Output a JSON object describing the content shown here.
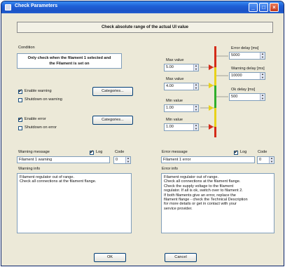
{
  "window": {
    "title": "Check Parameters"
  },
  "banner": "Check absolute range of the actual UI value",
  "condition": {
    "label": "Condition",
    "text": "Only check when the filament 1 selected and\nthe Filament is set on"
  },
  "checks": {
    "enable_warning": "Enable warning",
    "shutdown_warning": "Shutdown on warning",
    "enable_error": "Enable error",
    "shutdown_error": "Shutdown on error"
  },
  "buttons": {
    "categories": "Categories...",
    "ok": "OK",
    "cancel": "Cancel"
  },
  "limits": {
    "max1": {
      "label": "Max value",
      "value": "5.00"
    },
    "max2": {
      "label": "Max value",
      "value": "4.00"
    },
    "min1": {
      "label": "Min value",
      "value": "1.00"
    },
    "min2": {
      "label": "Min value",
      "value": "1.00"
    }
  },
  "delays": {
    "error": {
      "label": "Error delay [ms]",
      "value": "5000"
    },
    "warning": {
      "label": "Warning delay [ms]",
      "value": "10000"
    },
    "ok": {
      "label": "Ok delay [ms]",
      "value": "500"
    }
  },
  "warning": {
    "message_label": "Warning message",
    "log_label": "Log",
    "code_label": "Code",
    "message": "Filament 1 warning",
    "code": "0",
    "info_label": "Warning info",
    "info": "Filament regulator out of range.\nCheck all connections at the filament flange."
  },
  "error": {
    "message_label": "Error message",
    "log_label": "Log",
    "code_label": "Code",
    "message": "Filament 1 error",
    "code": "0",
    "info_label": "Error info",
    "info": "Filament regulator out of range.\nCheck all connections at the filament flange.\nCheck the supply voltage to the filament\nregulator. If all is ok, switch over to filament 2.\nIf both filaments give an error, replace the\nfilament flange - check the Technical Description\nfor more details or get in contact with your\nservice provider."
  },
  "colors": {
    "red": "#d42a18",
    "yellow": "#e8d21a",
    "green": "#2fae2a",
    "title_blue": "#1f5fd6"
  }
}
